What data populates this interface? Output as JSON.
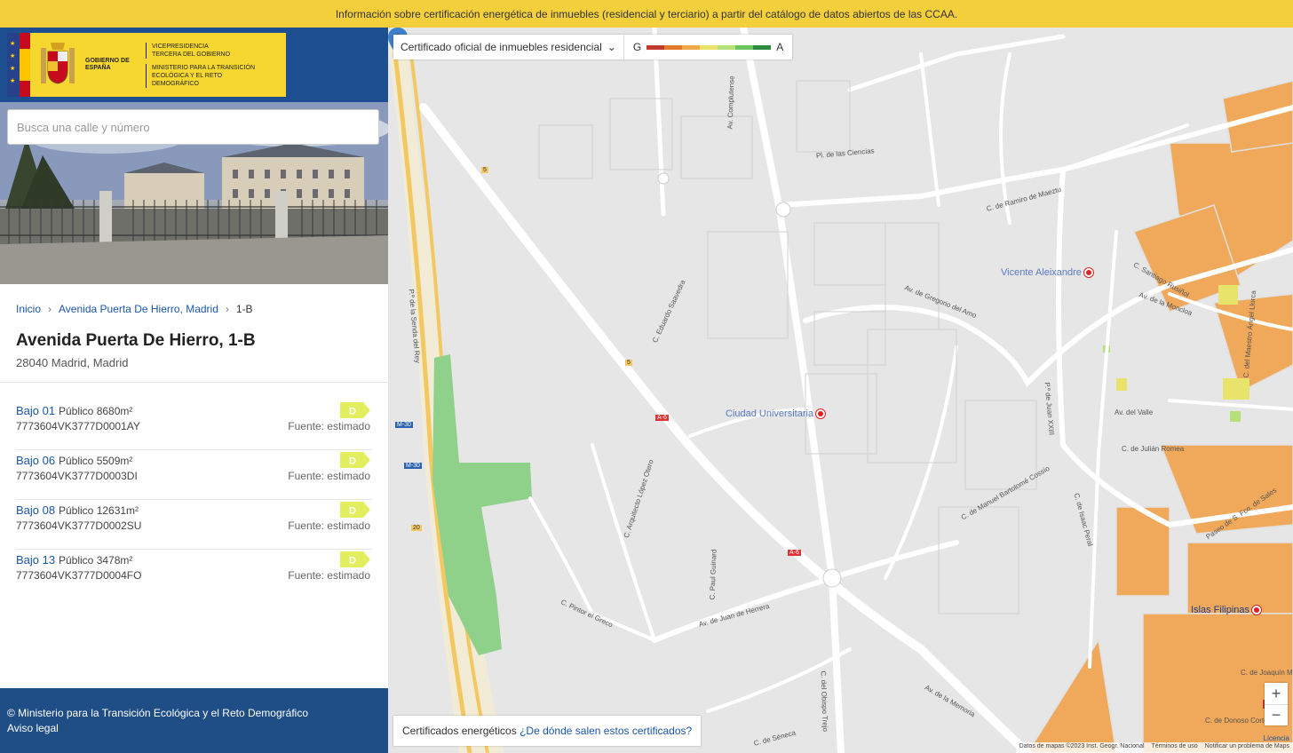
{
  "banner": {
    "text": "Información sobre certificación energética de inmuebles (residencial y terciario) a partir del catálogo de datos abiertos de las CCAA."
  },
  "gov": {
    "gobierno": "GOBIERNO DE ESPAÑA",
    "vice": "VICEPRESIDENCIA TERCERA DEL GOBIERNO",
    "ministerio": "MINISTERIO PARA LA TRANSICIÓN ECOLÓGICA Y EL RETO DEMOGRÁFICO"
  },
  "search": {
    "placeholder": "Busca una calle y número"
  },
  "breadcrumb": {
    "home": "Inicio",
    "street": "Avenida Puerta De Hierro, Madrid",
    "current": "1-B"
  },
  "address": {
    "title": "Avenida Puerta De Hierro, 1-B",
    "subtitle": "28040 Madrid, Madrid"
  },
  "units": [
    {
      "name": "Bajo 01",
      "use": "Público 8680m²",
      "ref": "7773604VK3777D0001AY",
      "rating": "D",
      "source": "Fuente: estimado"
    },
    {
      "name": "Bajo 06",
      "use": "Público 5509m²",
      "ref": "7773604VK3777D0003DI",
      "rating": "D",
      "source": "Fuente: estimado"
    },
    {
      "name": "Bajo 08",
      "use": "Público 12631m²",
      "ref": "7773604VK3777D0002SU",
      "rating": "D",
      "source": "Fuente: estimado"
    },
    {
      "name": "Bajo 13",
      "use": "Público 3478m²",
      "ref": "7773604VK3777D0004FO",
      "rating": "D",
      "source": "Fuente: estimado"
    }
  ],
  "footer": {
    "copyright": "© Ministerio para la Transición Ecológica y el Reto Demográfico",
    "legal": "Aviso legal"
  },
  "map": {
    "layer_select": "Certificado oficial de inmuebles residencial",
    "scale_low": "G",
    "scale_high": "A",
    "scale_colors": [
      "#c0392b",
      "#e07b2b",
      "#f0a848",
      "#e8e36a",
      "#b8e07a",
      "#6cc35f",
      "#2e8b3e"
    ],
    "info_label": "Certificados energéticos",
    "info_link": "¿De dónde salen estos certificados?",
    "zoom_in": "+",
    "zoom_out": "−",
    "licence": "Licencia",
    "attribution": [
      "Datos de mapas ©2023 Inst. Geogr. Nacional",
      "Términos de uso",
      "Notificar un problema de Maps"
    ],
    "metro_stations": [
      "Vicente Aleixandre",
      "Ciudad Universitaria",
      "Islas Filipinas"
    ],
    "streets": [
      "Av. Complutense",
      "C. de Ramiro de Maeztu",
      "Av. de Gregorio del Amo",
      "Pl. de las Ciencias",
      "C. Eduardo Saavedra",
      "C. Arquitecto López Otero",
      "C. Pintor el Greco",
      "C. Paul Guinard",
      "Av. de Juan de Herrera",
      "C. del Obispo Trejo",
      "Av. de la Memoria",
      "C. de Isaac Peral",
      "P.º de Juan XXIII",
      "Av. de la Moncloa",
      "C. Santiago Rusiñol",
      "C. de Julián Romea",
      "Av. del Valle",
      "C. de Manuel Bartolomé Cossío",
      "Paseo de S. Fco. de Sales",
      "C. de Donoso Cortés",
      "C. de Séneca",
      "P.º de la Senda del Rey",
      "C. de Joaquín M",
      "C. del Maestro Ángel Llorca"
    ],
    "road_shields": [
      "5",
      "5",
      "A-6",
      "A-6",
      "M-30",
      "M-30",
      "20"
    ]
  }
}
